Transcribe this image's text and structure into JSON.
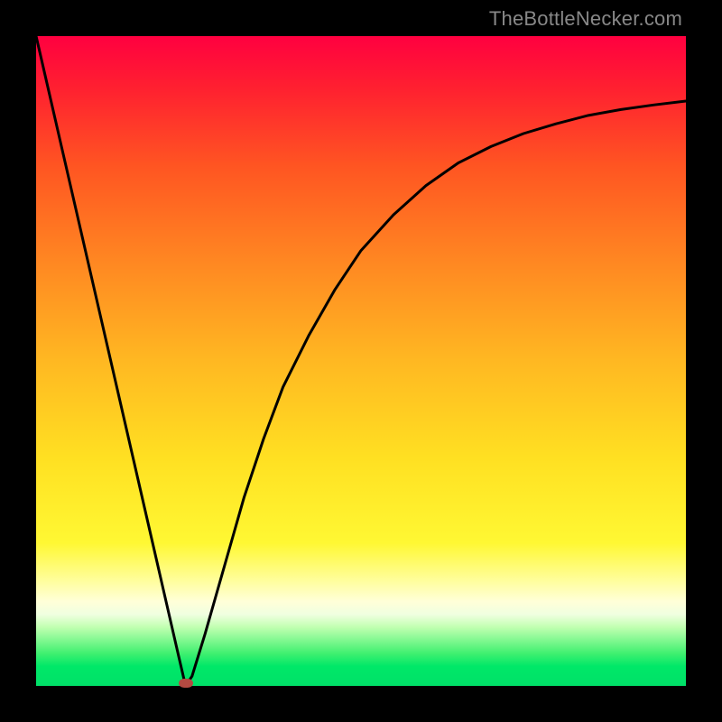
{
  "watermark": "TheBottleNecker.com",
  "colors": {
    "marker": "#b44a42",
    "curve": "#000000"
  },
  "chart_data": {
    "type": "line",
    "title": "",
    "xlabel": "",
    "ylabel": "",
    "xlim": [
      0,
      100
    ],
    "ylim": [
      0,
      100
    ],
    "x": [
      0,
      2,
      4,
      6,
      8,
      10,
      12,
      14,
      16,
      18,
      20,
      22,
      23,
      24,
      26,
      28,
      30,
      32,
      35,
      38,
      42,
      46,
      50,
      55,
      60,
      65,
      70,
      75,
      80,
      85,
      90,
      95,
      100
    ],
    "values": [
      100,
      91.3,
      82.6,
      73.9,
      65.2,
      56.5,
      47.8,
      39.1,
      30.4,
      21.7,
      13.0,
      4.3,
      0,
      1.5,
      8,
      15,
      22,
      29,
      38,
      46,
      54,
      61,
      67,
      72.5,
      77,
      80.5,
      83,
      85,
      86.5,
      87.8,
      88.7,
      89.4,
      90
    ],
    "marker": {
      "x": 23,
      "y": 0
    },
    "annotations": [],
    "grid": false,
    "legend": false
  }
}
